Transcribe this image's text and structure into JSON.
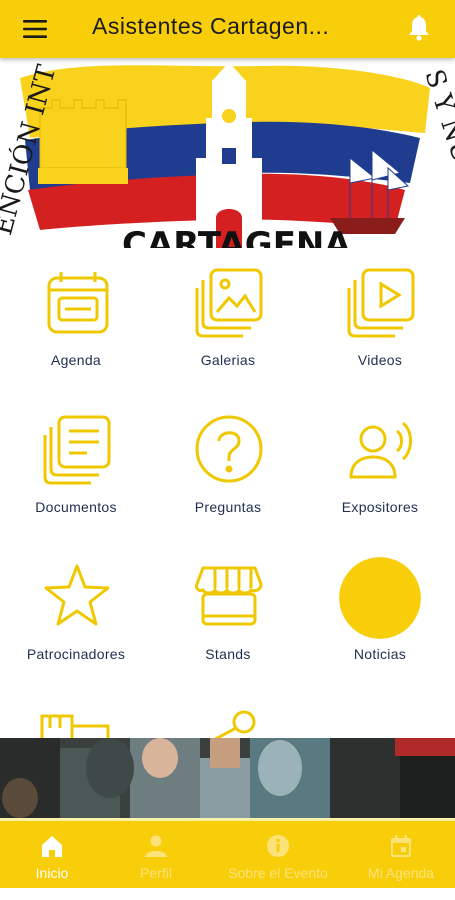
{
  "appbar": {
    "title": "Asistentes Cartagen...",
    "menu_icon": "menu-icon",
    "bell_icon": "bell-icon"
  },
  "banner": {
    "arc_text_left": "ENCIÓN INT",
    "arc_text_right": "S Y NUMISM",
    "city_text": "CARTAGENA"
  },
  "tiles": [
    {
      "label": "Agenda",
      "icon": "calendar-icon"
    },
    {
      "label": "Galerias",
      "icon": "gallery-icon"
    },
    {
      "label": "Videos",
      "icon": "video-icon"
    },
    {
      "label": "Documentos",
      "icon": "documents-icon"
    },
    {
      "label": "Preguntas",
      "icon": "question-icon"
    },
    {
      "label": "Expositores",
      "icon": "speaker-icon"
    },
    {
      "label": "Patrocinadores",
      "icon": "star-icon"
    },
    {
      "label": "Stands",
      "icon": "stand-icon"
    },
    {
      "label": "Noticias",
      "icon": "news-circle-icon"
    }
  ],
  "bottom_nav": [
    {
      "label": "Inicio",
      "icon": "home-icon",
      "active": true
    },
    {
      "label": "Perfil",
      "icon": "person-icon",
      "active": false
    },
    {
      "label": "Sobre el Evento",
      "icon": "info-icon",
      "active": false
    },
    {
      "label": "Mi Agenda",
      "icon": "agenda-icon",
      "active": false
    }
  ],
  "colors": {
    "accent": "#F8CE0B",
    "label_text": "#1f2f4f",
    "flag_yellow": "#F8D21C",
    "flag_blue": "#1f3c8f",
    "flag_red": "#d42020"
  }
}
